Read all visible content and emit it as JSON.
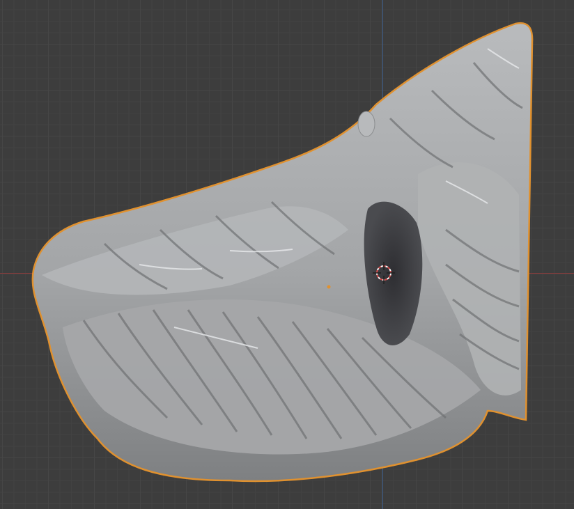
{
  "viewport": {
    "grid_color": "#464646",
    "background_color": "#3d3d3d",
    "x_axis_color": "#8a3b3b",
    "y_axis_color": "#3f5e8a",
    "selection_outline_color": "#e0912f",
    "mesh_color": "#a9abad"
  },
  "object": {
    "name_icon": "sculpt-mesh",
    "selected": true
  },
  "cursor": {
    "icon": "3d-cursor-icon"
  }
}
